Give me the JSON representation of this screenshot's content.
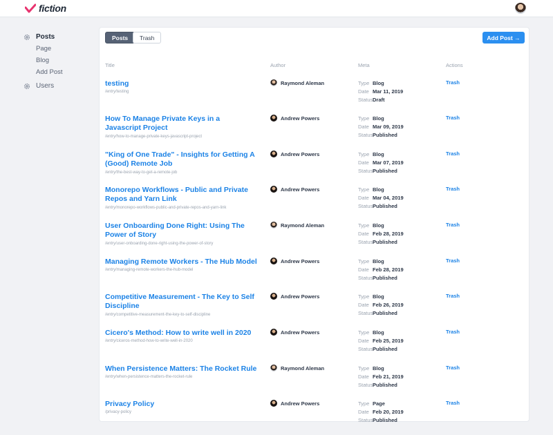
{
  "app": {
    "logo_text": "fiction",
    "brand_color": "#e8336f",
    "accent_color": "#2b8ff0"
  },
  "sidebar": {
    "posts_label": "Posts",
    "sub_items": [
      "Page",
      "Blog",
      "Add Post"
    ],
    "users_label": "Users"
  },
  "toolbar": {
    "tabs": [
      "Posts",
      "Trash"
    ],
    "active_tab": "Posts",
    "add_post_label": "Add Post →"
  },
  "table": {
    "columns": [
      "Title",
      "Author",
      "Meta",
      "Actions"
    ],
    "meta_keys": {
      "type": "Type",
      "date": "Date",
      "status": "Status"
    },
    "rows": [
      {
        "title": "testing",
        "path": "/entry/testing",
        "author": "Raymond Aleman",
        "type": "Blog",
        "date": "Mar 11, 2019",
        "status": "Draft",
        "action": "Trash"
      },
      {
        "title": "How To Manage Private Keys in a Javascript Project",
        "path": "/entry/how-to-manage-private-keys-javascript-project",
        "author": "Andrew Powers",
        "type": "Blog",
        "date": "Mar 09, 2019",
        "status": "Published",
        "action": "Trash"
      },
      {
        "title": "\"King of One Trade\" - Insights for Getting A (Good) Remote Job",
        "path": "/entry/the-best-way-to-get-a-remote-job",
        "author": "Andrew Powers",
        "type": "Blog",
        "date": "Mar 07, 2019",
        "status": "Published",
        "action": "Trash"
      },
      {
        "title": "Monorepo Workflows - Public and Private Repos and Yarn Link",
        "path": "/entry/monorepo-workflows-public-and-private-repos-and-yarn-link",
        "author": "Andrew Powers",
        "type": "Blog",
        "date": "Mar 04, 2019",
        "status": "Published",
        "action": "Trash"
      },
      {
        "title": "User Onboarding Done Right: Using The Power of Story",
        "path": "/entry/user-onboarding-done-right-using-the-power-of-story",
        "author": "Raymond Aleman",
        "type": "Blog",
        "date": "Feb 28, 2019",
        "status": "Published",
        "action": "Trash"
      },
      {
        "title": "Managing Remote Workers - The Hub Model",
        "path": "/entry/managing-remote-workers-the-hub-model",
        "author": "Andrew Powers",
        "type": "Blog",
        "date": "Feb 28, 2019",
        "status": "Published",
        "action": "Trash"
      },
      {
        "title": "Competitive Measurement - The Key to Self Discipline",
        "path": "/entry/competitive-measurement-the-key-to-self-discipline",
        "author": "Andrew Powers",
        "type": "Blog",
        "date": "Feb 26, 2019",
        "status": "Published",
        "action": "Trash"
      },
      {
        "title": "Cicero's Method: How to write well in 2020",
        "path": "/entry/ciceros-method-how-to-write-well-in-2020",
        "author": "Andrew Powers",
        "type": "Blog",
        "date": "Feb 25, 2019",
        "status": "Published",
        "action": "Trash"
      },
      {
        "title": "When Persistence Matters: The Rocket Rule",
        "path": "/entry/when-persistence-matters-the-rocket-rule",
        "author": "Raymond Aleman",
        "type": "Blog",
        "date": "Feb 21, 2019",
        "status": "Published",
        "action": "Trash"
      },
      {
        "title": "Privacy Policy",
        "path": "/privacy-policy",
        "author": "Andrew Powers",
        "type": "Page",
        "date": "Feb 20, 2019",
        "status": "Published",
        "action": "Trash"
      }
    ]
  }
}
